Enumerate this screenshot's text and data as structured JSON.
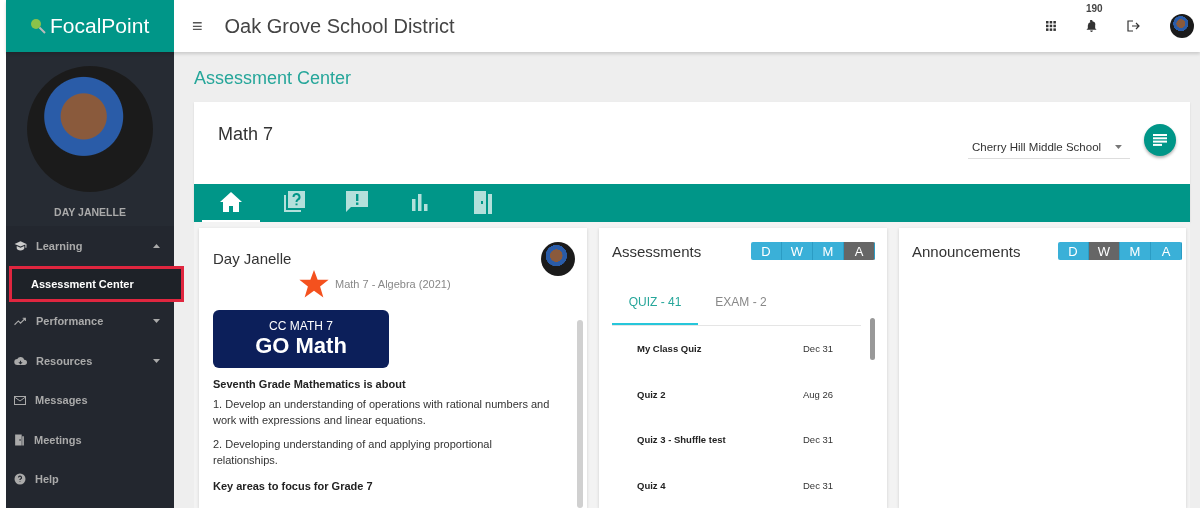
{
  "brand": {
    "name": "FocalPoint"
  },
  "topbar": {
    "menu_glyph": "≡",
    "title": "Oak Grove School District",
    "notification_count": "190"
  },
  "sidebar": {
    "user_name": "DAY JANELLE",
    "items": [
      {
        "label": "Learning",
        "expanded": true,
        "selected": false,
        "highlighted": false,
        "children": [
          {
            "label": "Assessment Center",
            "selected": true,
            "highlighted": true
          }
        ]
      },
      {
        "label": "Performance",
        "expanded": false,
        "selected": false,
        "highlighted": false
      },
      {
        "label": "Resources",
        "expanded": false,
        "selected": false,
        "highlighted": false
      },
      {
        "label": "Messages",
        "selected": false,
        "highlighted": false
      },
      {
        "label": "Meetings",
        "selected": false,
        "highlighted": false
      },
      {
        "label": "Help",
        "selected": false,
        "highlighted": false
      }
    ]
  },
  "page_title": "Assessment Center",
  "course": {
    "title": "Math 7",
    "school_select": {
      "value": "Cherry Hill Middle School"
    },
    "tabs": [
      {
        "selected": true
      },
      {
        "selected": false
      },
      {
        "selected": false
      },
      {
        "selected": false
      },
      {
        "selected": false
      }
    ]
  },
  "profile_panel": {
    "name": "Day Janelle",
    "subject": "Math 7 - Algebra (2021)",
    "logo": {
      "line1": "CC MATH 7",
      "line2": "GO Math"
    },
    "heading": "Seventh Grade Mathematics is about",
    "paragraphs": [
      "1. Develop an understanding of operations with rational numbers and work with expressions and linear equations.",
      "2. Developing understanding of and applying proportional relationships."
    ],
    "subheading": "Key areas to focus for Grade 7"
  },
  "assessments_panel": {
    "title": "Assessments",
    "periods": [
      {
        "label": "D",
        "selected": false
      },
      {
        "label": "W",
        "selected": false
      },
      {
        "label": "M",
        "selected": false
      },
      {
        "label": "A",
        "selected": true
      }
    ],
    "tabs": [
      {
        "label": "QUIZ - 41",
        "selected": true
      },
      {
        "label": "EXAM - 2",
        "selected": false
      }
    ],
    "rows": [
      {
        "name": "My Class Quiz",
        "date": "Dec 31"
      },
      {
        "name": "Quiz 2",
        "date": "Aug 26"
      },
      {
        "name": "Quiz 3 - Shuffle test",
        "date": "Dec 31"
      },
      {
        "name": "Quiz 4",
        "date": "Dec 31"
      }
    ]
  },
  "announcements_panel": {
    "title": "Announcements",
    "periods": [
      {
        "label": "D",
        "selected": false
      },
      {
        "label": "W",
        "selected": true
      },
      {
        "label": "M",
        "selected": false
      },
      {
        "label": "A",
        "selected": false
      }
    ]
  }
}
